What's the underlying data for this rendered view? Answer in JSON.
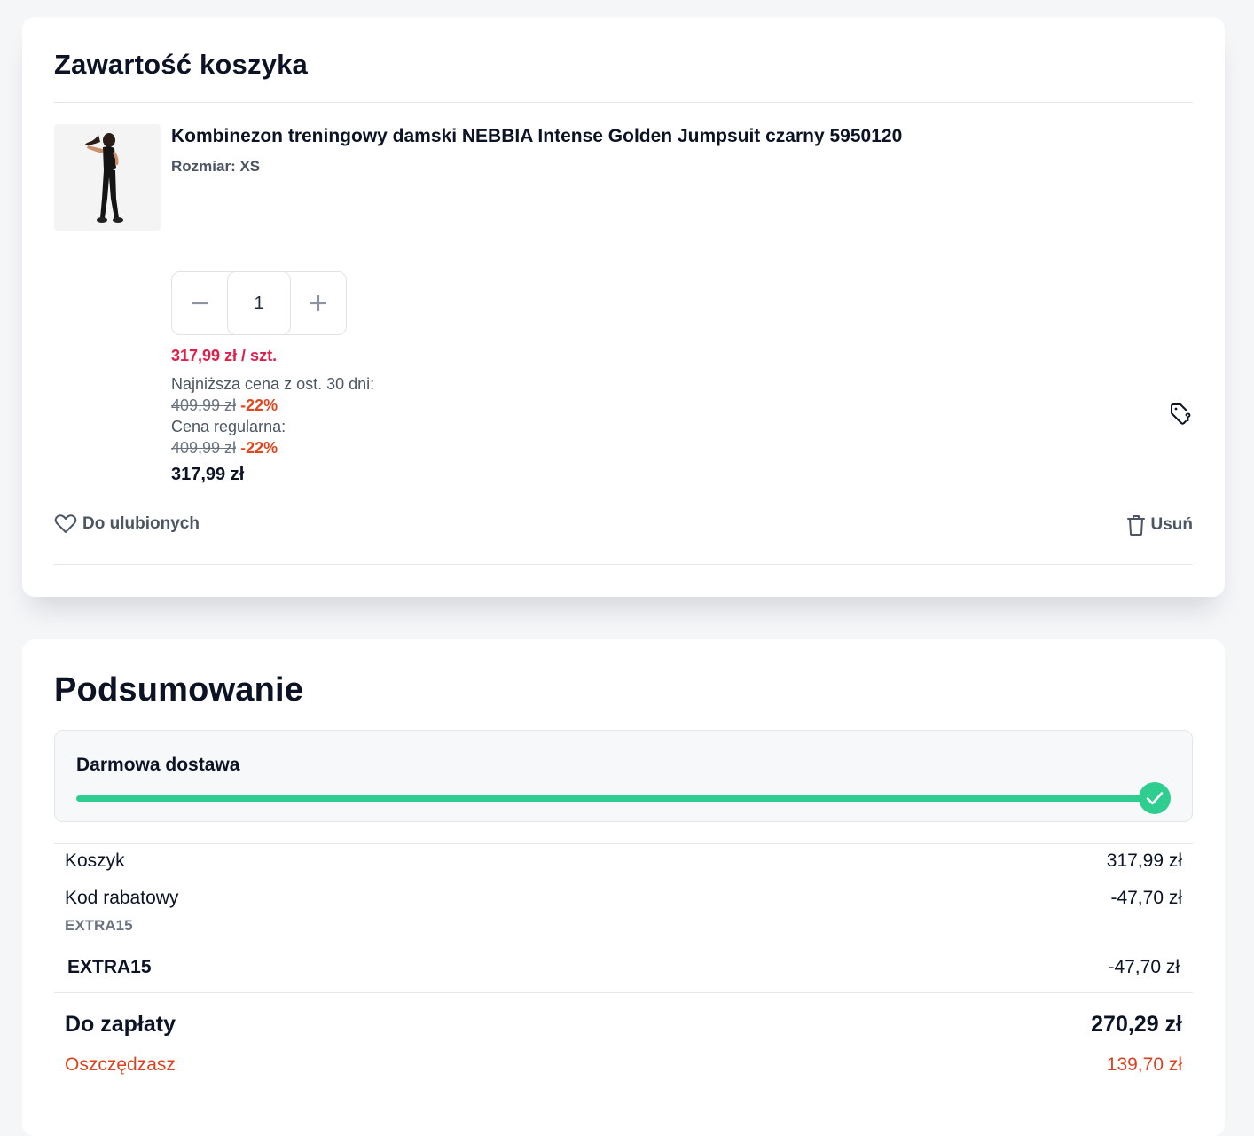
{
  "cart": {
    "title": "Zawartość koszyka",
    "item": {
      "name": "Kombinezon treningowy damski NEBBIA Intense Golden Jumpsuit czarny 5950120",
      "size": "Rozmiar: XS",
      "quantity": "1",
      "unit_price": "317,99 zł / szt.",
      "lowest_price_label": "Najniższa cena z ost. 30 dni:",
      "lowest_price_old": "409,99 zł",
      "lowest_price_discount": "-22%",
      "regular_price_label": "Cena regularna:",
      "regular_price_old": "409,99 zł",
      "regular_price_discount": "-22%",
      "final_price": "317,99 zł"
    },
    "favorite_label": "Do ulubionych",
    "remove_label": "Usuń"
  },
  "summary": {
    "title": "Podsumowanie",
    "free_shipping_label": "Darmowa dostawa",
    "free_shipping_progress": 1.0,
    "cart_label": "Koszyk",
    "cart_value": "317,99 zł",
    "discount_code_label": "Kod rabatowy",
    "discount_code_name": "EXTRA15",
    "discount_code_value": "-47,70 zł",
    "coupon_label": "EXTRA15",
    "coupon_value": "-47,70 zł",
    "total_label": "Do zapłaty",
    "total_value": "270,29 zł",
    "savings_label": "Oszczędzasz",
    "savings_value": "139,70 zł"
  },
  "colors": {
    "accent_green": "#2fce90",
    "price_red": "#e11d48",
    "discount_orange": "#e0471f"
  }
}
